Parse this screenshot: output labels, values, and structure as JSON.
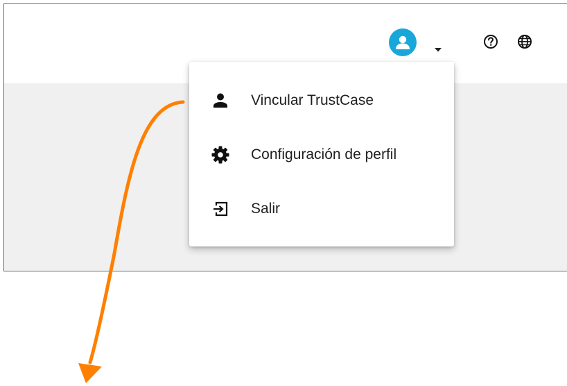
{
  "header": {
    "user_menu": {
      "avatar_icon": "user-avatar-icon",
      "avatar_color": "#19a7d9",
      "caret_icon": "caret-down-icon"
    },
    "help_icon": "help-circle-icon",
    "language_icon": "globe-icon"
  },
  "menu": {
    "items": [
      {
        "icon": "person-icon",
        "label": "Vincular TrustCase"
      },
      {
        "icon": "gear-icon",
        "label": "Configuración de perfil"
      },
      {
        "icon": "logout-icon",
        "label": "Salir"
      }
    ]
  },
  "annotation": {
    "arrow_color": "#ff8000"
  }
}
